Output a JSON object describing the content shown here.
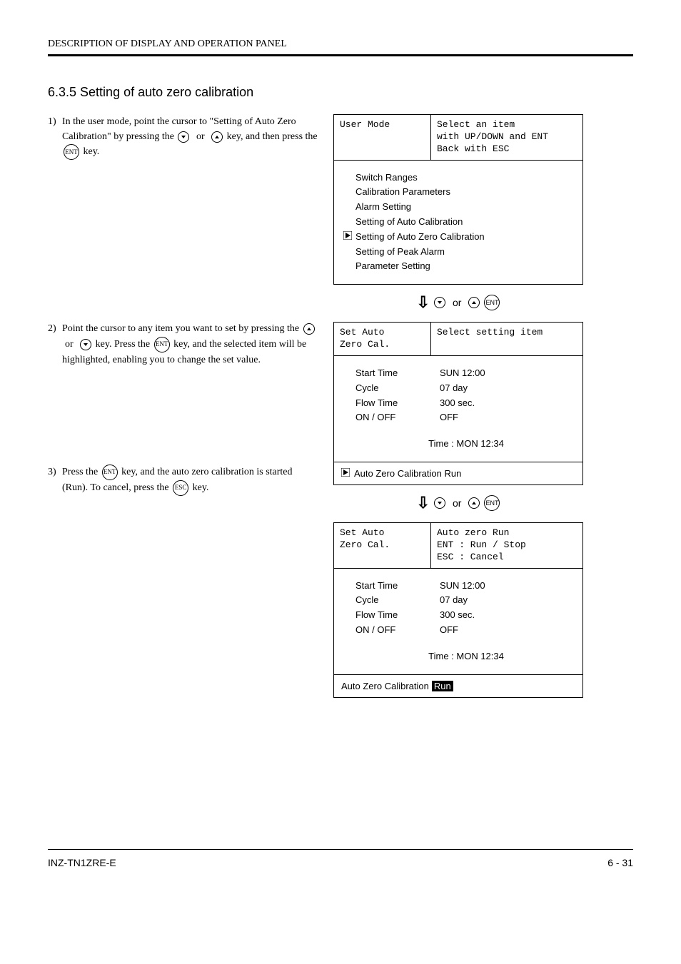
{
  "header": {
    "text": "DESCRIPTION OF DISPLAY AND OPERATION PANEL"
  },
  "section_title": "6.3.5 Setting of auto zero calibration",
  "instructions": [
    {
      "num": "1)",
      "pre": "In the user mode, point the cursor to \"Setting of Auto Zero Calibration\" by pressing the",
      "keys1": "DOWN_OR_UP",
      "mid": "key, and then press the",
      "keys2": "ENT",
      "post": "key."
    },
    {
      "num": "2)",
      "pre": "Point the cursor to any item you want to set by pressing the",
      "keys1": "UP_OR_DOWN",
      "mid": "key. Press the",
      "keys2": "ENT",
      "post": "key, and the selected item will be highlighted, enabling you to change the set value."
    },
    {
      "num": "3)",
      "pre": "Press the",
      "keys1": "ENT",
      "mid": "key, and the auto zero calibration is started (Run). To cancel, press the",
      "keys2": "ESC",
      "post": "key."
    }
  ],
  "words": {
    "or": "or",
    "ent": "ENT",
    "esc": "ESC"
  },
  "screen1": {
    "top_left": "User Mode",
    "top_right_l1": "Select an item",
    "top_right_l2": "with UP/DOWN and ENT",
    "top_right_l3": "Back with ESC",
    "items": [
      "Switch Ranges",
      "Calibration Parameters",
      "Alarm Setting",
      "Setting of Auto Calibration",
      "Setting of Auto Zero Calibration",
      "Setting of Peak Alarm",
      "Parameter Setting"
    ],
    "selected_index": 4
  },
  "transition1": {
    "ent": "ENT"
  },
  "screen2": {
    "top_left_l1": "Set Auto",
    "top_left_l2": "Zero Cal.",
    "top_right": "Select setting item",
    "params": [
      {
        "label": "Start Time",
        "value": "SUN 12:00"
      },
      {
        "label": "Cycle",
        "value": "07    day"
      },
      {
        "label": "Flow Time",
        "value": "300 sec."
      },
      {
        "label": "ON / OFF",
        "value": "OFF"
      }
    ],
    "time": "Time : MON 12:34",
    "footer_text": "Auto Zero Calibration Run"
  },
  "transition2": {
    "ent": "ENT"
  },
  "screen3": {
    "top_left_l1": "Set Auto",
    "top_left_l2": "Zero Cal.",
    "top_right_l1": "Auto zero Run",
    "top_right_l2": "ENT : Run / Stop",
    "top_right_l3": "ESC : Cancel",
    "params": [
      {
        "label": "Start Time",
        "value": "SUN 12:00"
      },
      {
        "label": "Cycle",
        "value": "07    day"
      },
      {
        "label": "Flow Time",
        "value": "300 sec."
      },
      {
        "label": "ON / OFF",
        "value": "OFF"
      }
    ],
    "time": "Time : MON 12:34",
    "footer_text": "Auto Zero Calibration",
    "footer_highlight": "Run"
  },
  "footer": {
    "left": "INZ-TN1ZRE-E",
    "right": "6 - 31"
  }
}
